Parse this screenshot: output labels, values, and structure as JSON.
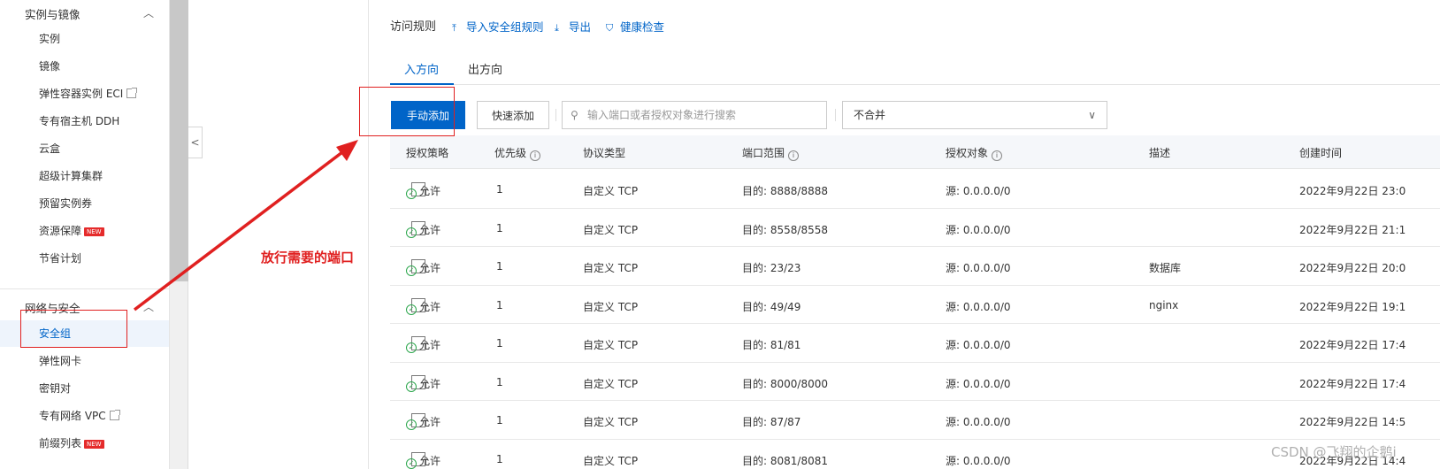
{
  "sidebar": {
    "group1": {
      "title": "实例与镜像"
    },
    "items1": [
      {
        "label": "实例"
      },
      {
        "label": "镜像"
      },
      {
        "label": "弹性容器实例 ECI",
        "external": true
      },
      {
        "label": "专有宿主机 DDH"
      },
      {
        "label": "云盒"
      },
      {
        "label": "超级计算集群"
      },
      {
        "label": "预留实例券"
      },
      {
        "label": "资源保障",
        "badge": "NEW"
      },
      {
        "label": "节省计划"
      }
    ],
    "group2": {
      "title": "网络与安全"
    },
    "items2": [
      {
        "label": "安全组",
        "active": true
      },
      {
        "label": "弹性网卡"
      },
      {
        "label": "密钥对"
      },
      {
        "label": "专有网络 VPC",
        "external": true
      },
      {
        "label": "前缀列表",
        "badge": "NEW"
      }
    ]
  },
  "toolbar": {
    "title": "访问规则",
    "import_label": "导入安全组规则",
    "export_label": "导出",
    "health_label": "健康检查"
  },
  "tabs": [
    {
      "label": "入方向"
    },
    {
      "label": "出方向"
    }
  ],
  "actions": {
    "manual_add": "手动添加",
    "quick_add": "快速添加",
    "search_placeholder": "输入端口或者授权对象进行搜索",
    "merge_select": "不合并"
  },
  "table": {
    "headers": {
      "policy": "授权策略",
      "priority": "优先级",
      "protocol": "协议类型",
      "port": "端口范围",
      "object": "授权对象",
      "desc": "描述",
      "created": "创建时间"
    },
    "rows": [
      {
        "policy": "允许",
        "priority": "1",
        "protocol": "自定义 TCP",
        "port": "目的: 8888/8888",
        "object": "源: 0.0.0.0/0",
        "desc": "",
        "created": "2022年9月22日 23:0"
      },
      {
        "policy": "允许",
        "priority": "1",
        "protocol": "自定义 TCP",
        "port": "目的: 8558/8558",
        "object": "源: 0.0.0.0/0",
        "desc": "",
        "created": "2022年9月22日 21:1"
      },
      {
        "policy": "允许",
        "priority": "1",
        "protocol": "自定义 TCP",
        "port": "目的: 23/23",
        "object": "源: 0.0.0.0/0",
        "desc": "数据库",
        "created": "2022年9月22日 20:0"
      },
      {
        "policy": "允许",
        "priority": "1",
        "protocol": "自定义 TCP",
        "port": "目的: 49/49",
        "object": "源: 0.0.0.0/0",
        "desc": "nginx",
        "created": "2022年9月22日 19:1"
      },
      {
        "policy": "允许",
        "priority": "1",
        "protocol": "自定义 TCP",
        "port": "目的: 81/81",
        "object": "源: 0.0.0.0/0",
        "desc": "",
        "created": "2022年9月22日 17:4"
      },
      {
        "policy": "允许",
        "priority": "1",
        "protocol": "自定义 TCP",
        "port": "目的: 8000/8000",
        "object": "源: 0.0.0.0/0",
        "desc": "",
        "created": "2022年9月22日 17:4"
      },
      {
        "policy": "允许",
        "priority": "1",
        "protocol": "自定义 TCP",
        "port": "目的: 87/87",
        "object": "源: 0.0.0.0/0",
        "desc": "",
        "created": "2022年9月22日 14:5"
      },
      {
        "policy": "允许",
        "priority": "1",
        "protocol": "自定义 TCP",
        "port": "目的: 8081/8081",
        "object": "源: 0.0.0.0/0",
        "desc": "",
        "created": "2022年9月22日 14:4"
      }
    ]
  },
  "annotation": {
    "text": "放行需要的端口"
  },
  "watermark": "CSDN @飞翔的企鹅i",
  "colors": {
    "accent": "#0064c8",
    "annotation": "#e02020",
    "allow": "#2fa84f"
  }
}
